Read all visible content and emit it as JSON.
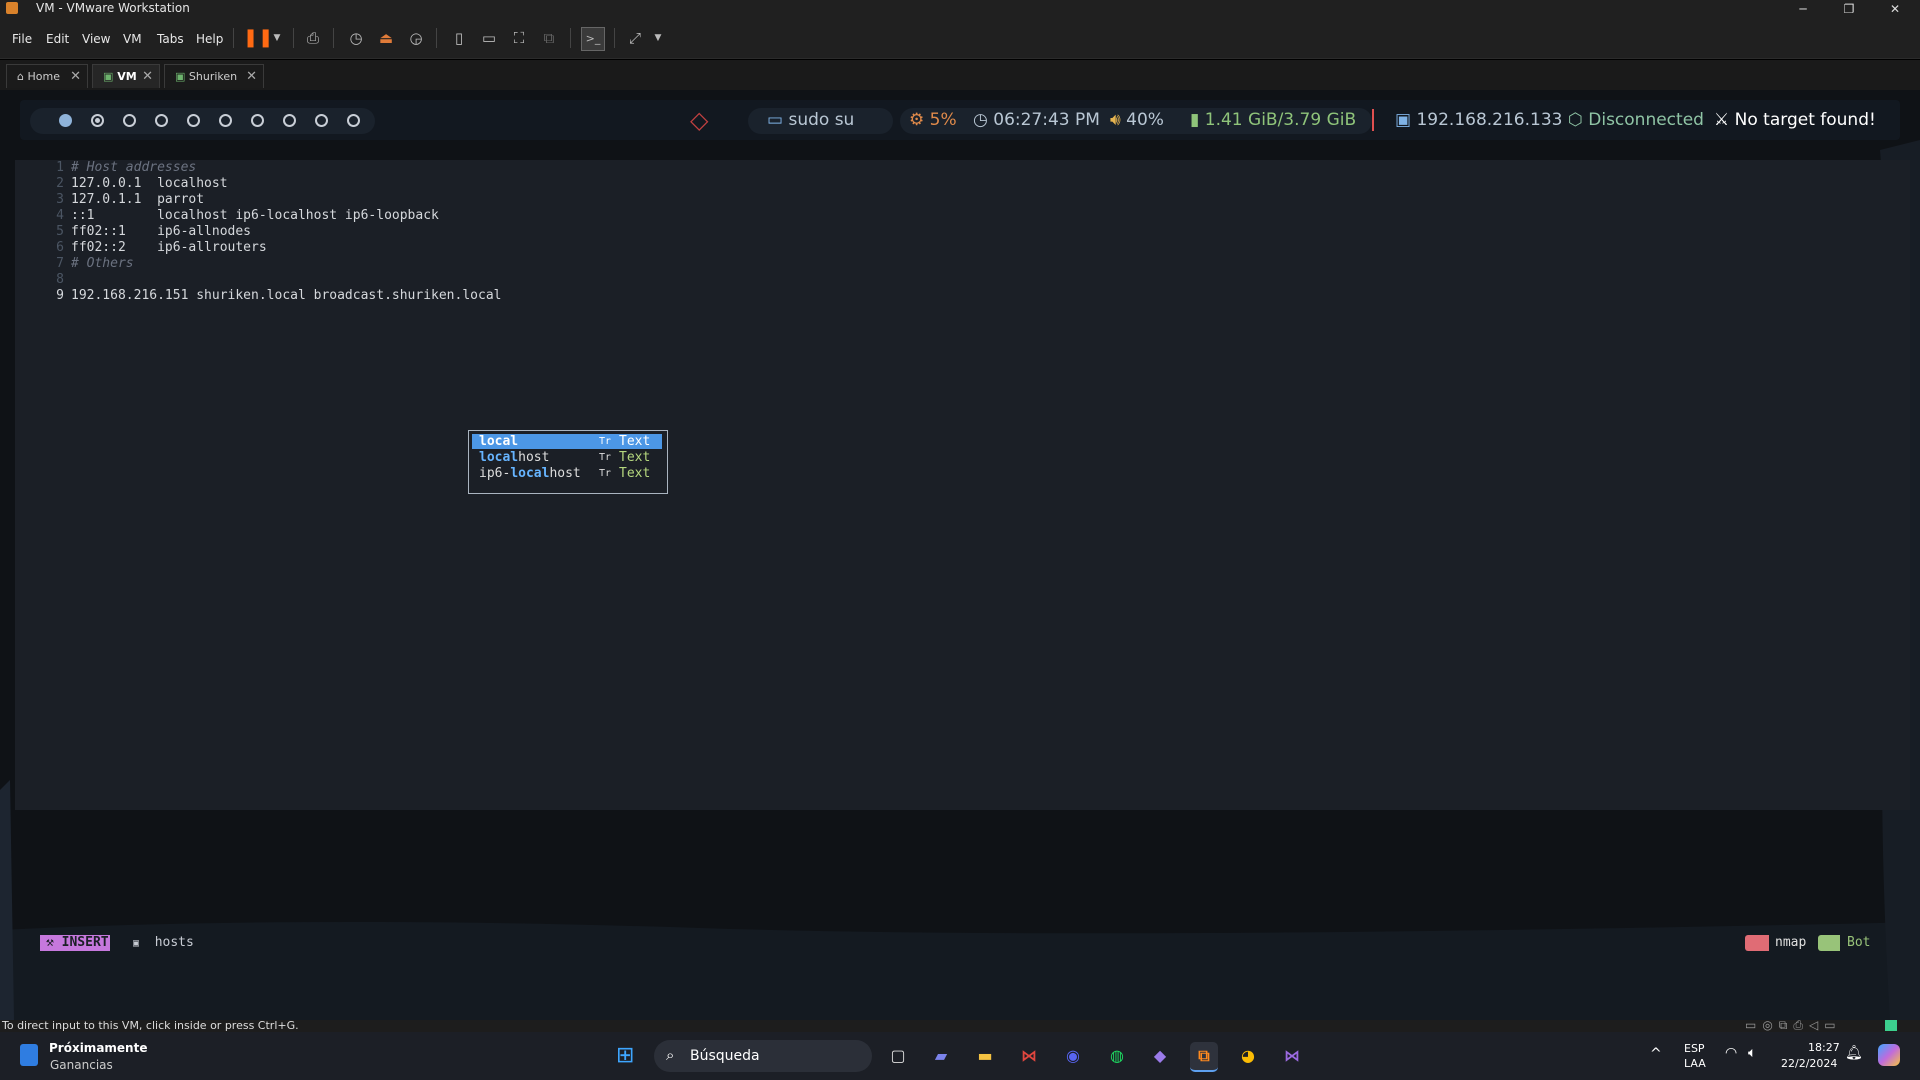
{
  "window": {
    "title": "VM - VMware Workstation",
    "minimize": "─",
    "restore": "❐",
    "close": "✕"
  },
  "menu": {
    "items": [
      "File",
      "Edit",
      "View",
      "VM",
      "Tabs",
      "Help"
    ]
  },
  "tabs": [
    {
      "label": "Home",
      "close": "✕"
    },
    {
      "label": "VM",
      "close": "✕"
    },
    {
      "label": "Shuriken",
      "close": "✕"
    }
  ],
  "polybar": {
    "terminal": "sudo su",
    "cpu": "5%",
    "time": "06:27:43 PM",
    "volume": "40%",
    "memory": "1.41 GiB/3.79 GiB",
    "ip": "192.168.216.133",
    "vpn": "Disconnected",
    "target": "No target found!"
  },
  "editor": {
    "lines": [
      {
        "n": "1",
        "text": "# Host addresses",
        "comment": true
      },
      {
        "n": "2",
        "text": "127.0.0.1  localhost",
        "comment": false
      },
      {
        "n": "3",
        "text": "127.0.1.1  parrot",
        "comment": false
      },
      {
        "n": "4",
        "text": "::1        localhost ip6-localhost ip6-loopback",
        "comment": false
      },
      {
        "n": "5",
        "text": "ff02::1    ip6-allnodes",
        "comment": false
      },
      {
        "n": "6",
        "text": "ff02::2    ip6-allrouters",
        "comment": false
      },
      {
        "n": "7",
        "text": "# Others",
        "comment": true
      },
      {
        "n": "8",
        "text": "",
        "comment": false
      },
      {
        "n": "9",
        "text": "192.168.216.151 shuriken.local broadcast.shuriken.local",
        "comment": false
      }
    ],
    "completion": [
      {
        "pre": "",
        "match": "local",
        "post": "",
        "kind": "Tr",
        "type": "Text"
      },
      {
        "pre": "",
        "match": "local",
        "post": "host",
        "kind": "Tr",
        "type": "Text"
      },
      {
        "pre": "ip6-",
        "match": "local",
        "post": "host",
        "kind": "Tr",
        "type": "Text"
      }
    ]
  },
  "statusline": {
    "mode": "INSERT",
    "file": "hosts",
    "lsp": "nmap",
    "position": "Bot"
  },
  "vm_status": "To direct input to this VM, click inside or press Ctrl+G.",
  "taskbar": {
    "widget_title": "Próximamente",
    "widget_sub": "Ganancias",
    "search": "Búsqueda",
    "lang": "ESP",
    "lang2": "LAA",
    "time": "18:27",
    "date": "22/2/2024"
  }
}
